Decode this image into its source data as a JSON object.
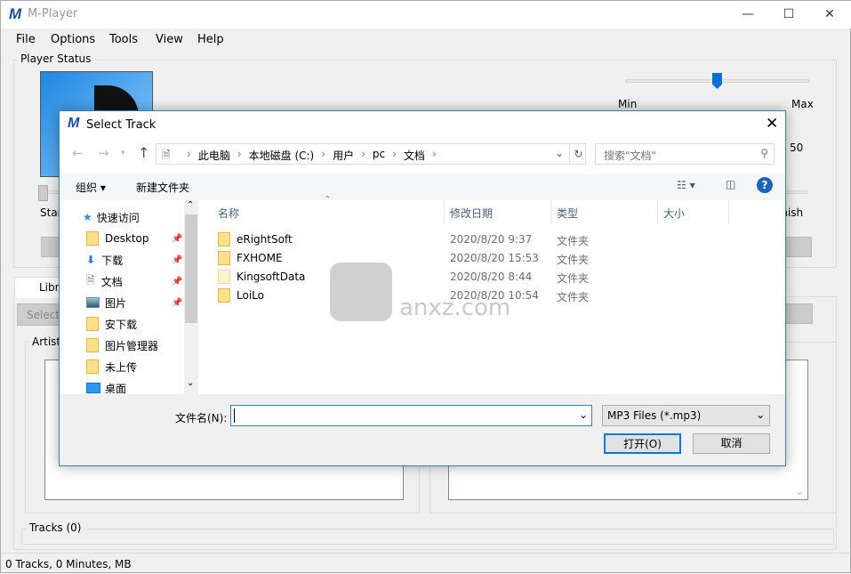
{
  "window": {
    "title": "M-Player",
    "logo": "M",
    "controls": {
      "minimize": "—",
      "maximize": "☐",
      "close": "✕"
    }
  },
  "menu": [
    "File",
    "Options",
    "Tools",
    "View",
    "Help"
  ],
  "player_status": {
    "label": "Player Status",
    "volume": {
      "value": 50,
      "min_label": "Min",
      "max_label": "Max",
      "value_label": "50"
    },
    "start_label": "Start",
    "finish_label": "Finish"
  },
  "library": {
    "tab_label": "Library",
    "select_label": "Select",
    "artist_label": "Artist",
    "tracks_label": "Tracks (0)"
  },
  "status_bar": "0 Tracks, 0 Minutes,  MB",
  "dialog": {
    "title": "Select Track",
    "logo": "M",
    "breadcrumb": [
      "此电脑",
      "本地磁盘 (C:)",
      "用户",
      "pc",
      "文档"
    ],
    "search_placeholder": "搜索\"文档\"",
    "toolbar": {
      "organize": "组织 ▾",
      "new_folder": "新建文件夹"
    },
    "nav": [
      {
        "label": "快速访问",
        "icon": "star-icon",
        "pinned": false
      },
      {
        "label": "Desktop",
        "icon": "folder-icon",
        "pinned": true
      },
      {
        "label": "下载",
        "icon": "download-icon",
        "pinned": true
      },
      {
        "label": "文档",
        "icon": "document-icon",
        "pinned": true
      },
      {
        "label": "图片",
        "icon": "picture-icon",
        "pinned": true
      },
      {
        "label": "安下载",
        "icon": "folder-icon",
        "pinned": false
      },
      {
        "label": "图片管理器",
        "icon": "folder-icon",
        "pinned": false
      },
      {
        "label": "未上传",
        "icon": "folder-icon",
        "pinned": false
      },
      {
        "label": "桌面",
        "icon": "desktop-icon",
        "pinned": false
      }
    ],
    "columns": [
      "名称",
      "修改日期",
      "类型",
      "大小"
    ],
    "files": [
      {
        "name": "eRightSoft",
        "date": "2020/8/20 9:37",
        "type": "文件夹"
      },
      {
        "name": "FXHOME",
        "date": "2020/8/20 15:53",
        "type": "文件夹"
      },
      {
        "name": "KingsoftData",
        "date": "2020/8/20 8:44",
        "type": "文件夹"
      },
      {
        "name": "LoiLo",
        "date": "2020/8/20 10:54",
        "type": "文件夹"
      }
    ],
    "filename_label": "文件名(N):",
    "filename_value": "",
    "filetype": "MP3 Files (*.mp3)",
    "open_button": "打开(O)",
    "cancel_button": "取消"
  },
  "watermark": "anxz.com"
}
